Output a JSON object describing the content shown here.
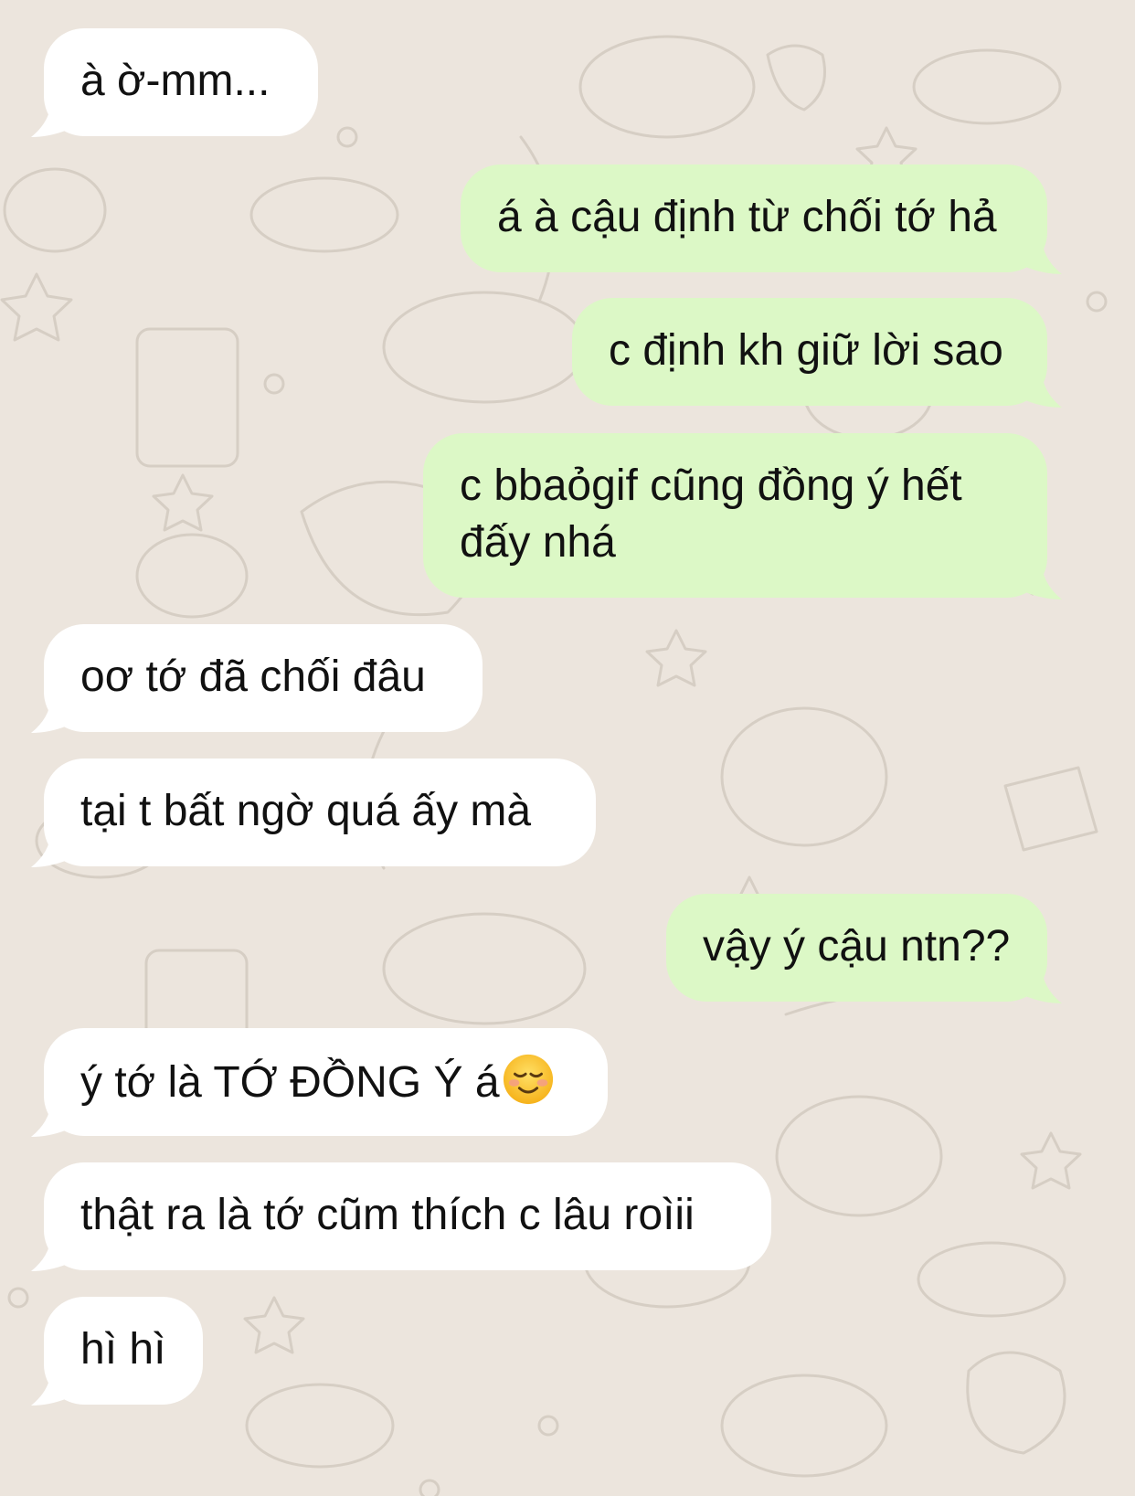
{
  "chat": {
    "background_color": "#ece5dd",
    "incoming_color": "#ffffff",
    "outgoing_color": "#dcf8c6",
    "messages": [
      {
        "side": "incoming",
        "text": "à ờ-mm..."
      },
      {
        "side": "outgoing",
        "text": "á à cậu định từ chối tớ hả"
      },
      {
        "side": "outgoing",
        "text": "c định kh giữ lời sao"
      },
      {
        "side": "outgoing",
        "text": "c bbaỏgif cũng đồng ý hết đấy nhá"
      },
      {
        "side": "incoming",
        "text": "oơ tớ đã chối đâu"
      },
      {
        "side": "incoming",
        "text": "tại t bất ngờ quá ấy mà"
      },
      {
        "side": "outgoing",
        "text": "vậy ý cậu ntn??"
      },
      {
        "side": "incoming",
        "text": "ý tớ là TỚ ĐỒNG Ý á",
        "emoji": "smiling-face-emoji"
      },
      {
        "side": "incoming",
        "text": "thật ra là tớ cũm thích c lâu roìii"
      },
      {
        "side": "incoming",
        "text": "hì hì"
      }
    ]
  }
}
